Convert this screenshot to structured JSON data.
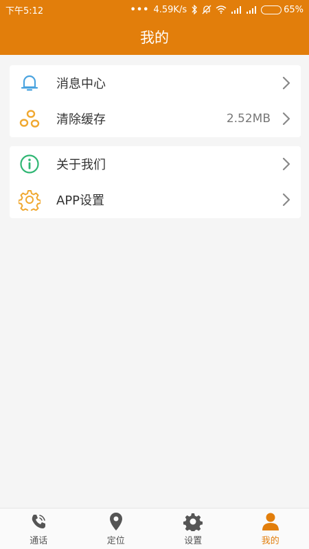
{
  "status_bar": {
    "time": "下午5:12",
    "dots": "•••",
    "speed": "4.59K/s",
    "battery_percent": "65%",
    "battery_level": 0.65
  },
  "header": {
    "title": "我的"
  },
  "menu_groups": [
    {
      "items": [
        {
          "label": "消息中心",
          "icon": "bell-icon"
        },
        {
          "label": "清除缓存",
          "value": "2.52MB",
          "icon": "clear-cache-icon"
        }
      ]
    },
    {
      "items": [
        {
          "label": "关于我们",
          "icon": "info-icon"
        },
        {
          "label": "APP设置",
          "icon": "gear-icon"
        }
      ]
    }
  ],
  "tabs": [
    {
      "label": "通话",
      "icon": "phone-icon"
    },
    {
      "label": "定位",
      "icon": "location-pin-icon"
    },
    {
      "label": "设置",
      "icon": "settings-gear-icon"
    },
    {
      "label": "我的",
      "icon": "person-icon",
      "active": true
    }
  ],
  "colors": {
    "accent": "#e27e0b",
    "bell": "#4aa3df",
    "info": "#2fb673",
    "gear": "#f0a830",
    "chevron": "#888888"
  }
}
